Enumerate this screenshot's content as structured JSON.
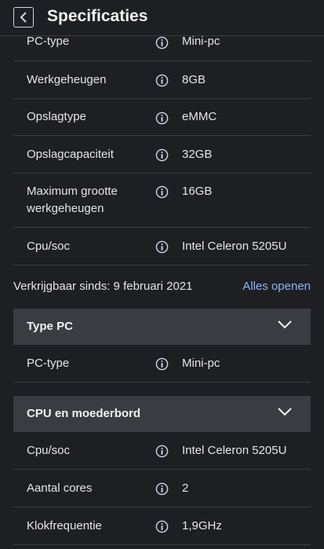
{
  "header": {
    "title": "Specificaties"
  },
  "top_specs": [
    {
      "label": "PC-type",
      "value": "Mini-pc"
    },
    {
      "label": "Werkgeheugen",
      "value": "8GB"
    },
    {
      "label": "Opslagtype",
      "value": "eMMC"
    },
    {
      "label": "Opslagcapaciteit",
      "value": "32GB"
    },
    {
      "label": "Maximum grootte",
      "label2": "werkgeheugen",
      "value": "16GB"
    },
    {
      "label": "Cpu/soc",
      "value": "Intel Celeron 5205U"
    }
  ],
  "availability": {
    "text": "Verkrijgbaar sinds: 9 februari 2021",
    "open_all": "Alles openen"
  },
  "sections": [
    {
      "title": "Type PC",
      "rows": [
        {
          "label": "PC-type",
          "value": "Mini-pc"
        }
      ]
    },
    {
      "title": "CPU en moederbord",
      "rows": [
        {
          "label": "Cpu/soc",
          "value": "Intel Celeron 5205U"
        },
        {
          "label": "Aantal cores",
          "value": "2"
        },
        {
          "label": "Klokfrequentie",
          "value": "1,9GHz"
        }
      ]
    }
  ],
  "colors": {
    "background": "#1e1f22",
    "section_bg": "#3a3c41",
    "link": "#8ab4f8",
    "info_icon": "#cfd8e8"
  }
}
